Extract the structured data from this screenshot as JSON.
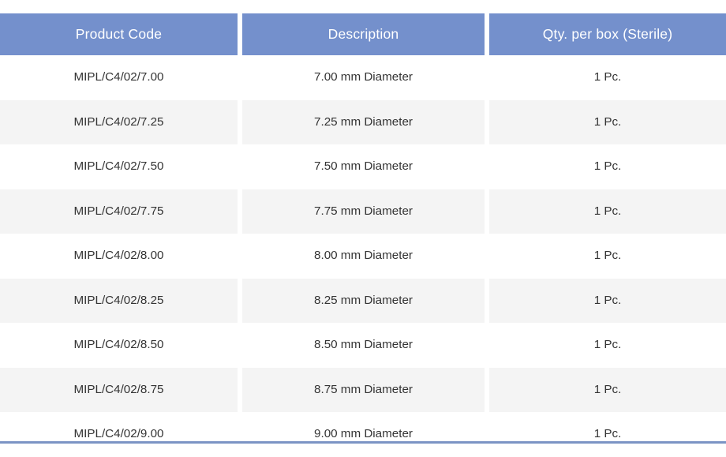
{
  "table": {
    "columns": [
      {
        "key": "product_code",
        "label": "Product Code"
      },
      {
        "key": "description",
        "label": "Description"
      },
      {
        "key": "qty",
        "label": "Qty. per box (Sterile)"
      }
    ],
    "rows": [
      {
        "product_code": "MIPL/C4/02/7.00",
        "description": "7.00 mm Diameter",
        "qty": "1 Pc."
      },
      {
        "product_code": "MIPL/C4/02/7.25",
        "description": "7.25 mm Diameter",
        "qty": "1 Pc."
      },
      {
        "product_code": "MIPL/C4/02/7.50",
        "description": "7.50 mm Diameter",
        "qty": "1 Pc."
      },
      {
        "product_code": "MIPL/C4/02/7.75",
        "description": "7.75 mm Diameter",
        "qty": "1 Pc."
      },
      {
        "product_code": "MIPL/C4/02/8.00",
        "description": "8.00 mm Diameter",
        "qty": "1 Pc."
      },
      {
        "product_code": "MIPL/C4/02/8.25",
        "description": "8.25 mm Diameter",
        "qty": "1 Pc."
      },
      {
        "product_code": "MIPL/C4/02/8.50",
        "description": "8.50 mm Diameter",
        "qty": "1 Pc."
      },
      {
        "product_code": "MIPL/C4/02/8.75",
        "description": "8.75 mm Diameter",
        "qty": "1 Pc."
      },
      {
        "product_code": "MIPL/C4/02/9.00",
        "description": "9.00 mm Diameter",
        "qty": "1 Pc."
      }
    ],
    "colors": {
      "header_background": "#7490cc",
      "header_text": "#ffffff",
      "row_background": "#ffffff",
      "row_alt_background": "#f4f4f4",
      "body_text": "#333333",
      "bottom_rule": "#7b94c4"
    }
  }
}
